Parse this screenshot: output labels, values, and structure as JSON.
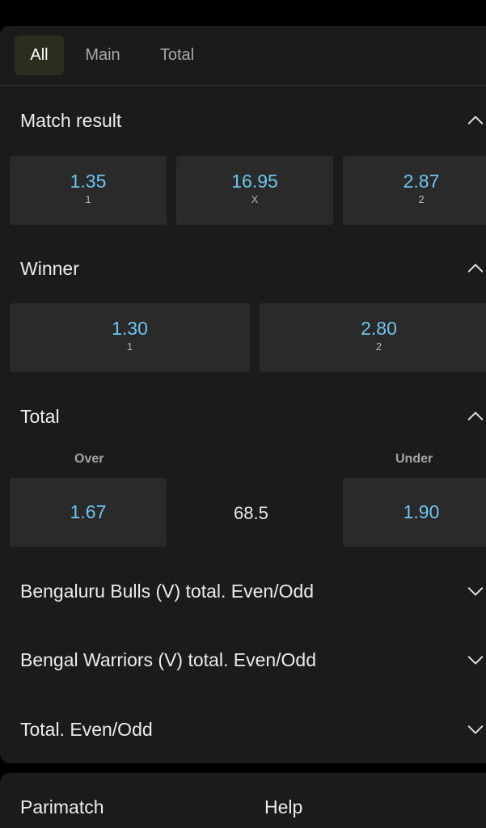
{
  "tabs": [
    {
      "label": "All",
      "active": true
    },
    {
      "label": "Main",
      "active": false
    },
    {
      "label": "Total",
      "active": false
    }
  ],
  "match_result": {
    "title": "Match result",
    "outcomes": [
      {
        "odds": "1.35",
        "label": "1"
      },
      {
        "odds": "16.95",
        "label": "X"
      },
      {
        "odds": "2.87",
        "label": "2"
      }
    ]
  },
  "winner": {
    "title": "Winner",
    "outcomes": [
      {
        "odds": "1.30",
        "label": "1"
      },
      {
        "odds": "2.80",
        "label": "2"
      }
    ]
  },
  "total": {
    "title": "Total",
    "over_label": "Over",
    "under_label": "Under",
    "over_odds": "1.67",
    "line": "68.5",
    "under_odds": "1.90"
  },
  "collapsed_markets": [
    {
      "title": "Bengaluru Bulls (V) total. Even/Odd"
    },
    {
      "title": "Bengal Warriors (V) total. Even/Odd"
    },
    {
      "title": "Total. Even/Odd"
    }
  ],
  "footer": {
    "brand": "Parimatch",
    "help": "Help"
  },
  "colors": {
    "odds": "#6cc4f0",
    "panel": "#1b1b1b",
    "cell": "#2a2a2a",
    "active_tab": "#2d2d1d"
  },
  "icons": {
    "expanded": "chevron-up-icon",
    "collapsed": "chevron-down-icon"
  }
}
